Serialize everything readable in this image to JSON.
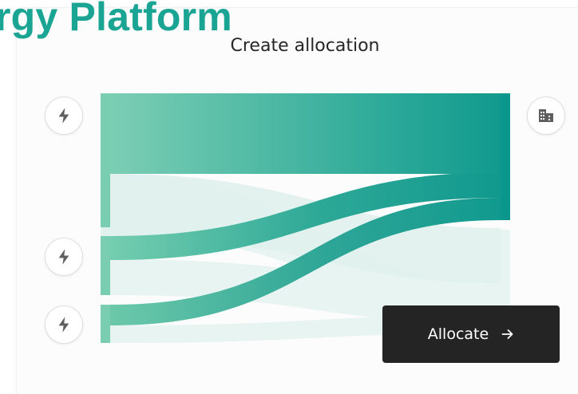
{
  "header": {
    "platform_title": "rgy Platform"
  },
  "allocation": {
    "title": "Create allocation",
    "allocate_label": "Allocate",
    "source_icons": [
      "bolt-icon",
      "bolt-icon",
      "bolt-icon"
    ],
    "destination_icon": "building-icon"
  },
  "colors": {
    "accent": "#1aa494",
    "flow_light": "#7ecfb4",
    "flow_dark": "#0f998d",
    "flow_background": "#e6f3f1",
    "button": "#242424"
  }
}
